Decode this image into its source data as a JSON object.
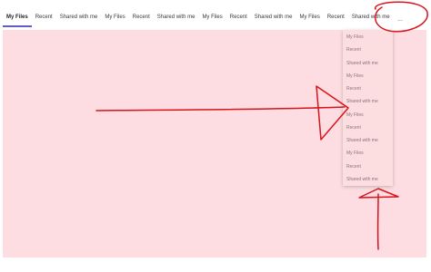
{
  "tabs": [
    {
      "label": "My Files",
      "active": true
    },
    {
      "label": "Recent"
    },
    {
      "label": "Shared with me"
    },
    {
      "label": "My Files"
    },
    {
      "label": "Recent"
    },
    {
      "label": "Shared with me"
    },
    {
      "label": "My Files"
    },
    {
      "label": "Recent"
    },
    {
      "label": "Shared with me"
    },
    {
      "label": "My Files"
    },
    {
      "label": "Recent"
    },
    {
      "label": "Shared with me"
    }
  ],
  "overflow": {
    "label": "..."
  },
  "menu": {
    "items": [
      {
        "label": "My Files"
      },
      {
        "label": "Recent"
      },
      {
        "label": "Shared with me"
      },
      {
        "label": "My Files"
      },
      {
        "label": "Recent"
      },
      {
        "label": "Shared with me"
      },
      {
        "label": "My Files"
      },
      {
        "label": "Recent"
      },
      {
        "label": "Shared with me"
      },
      {
        "label": "My Files"
      },
      {
        "label": "Recent"
      },
      {
        "label": "Shared with me"
      }
    ]
  },
  "colors": {
    "content_bg": "#fddde1",
    "active_underline": "#5b5fc7",
    "annotation": "#d8141c"
  }
}
